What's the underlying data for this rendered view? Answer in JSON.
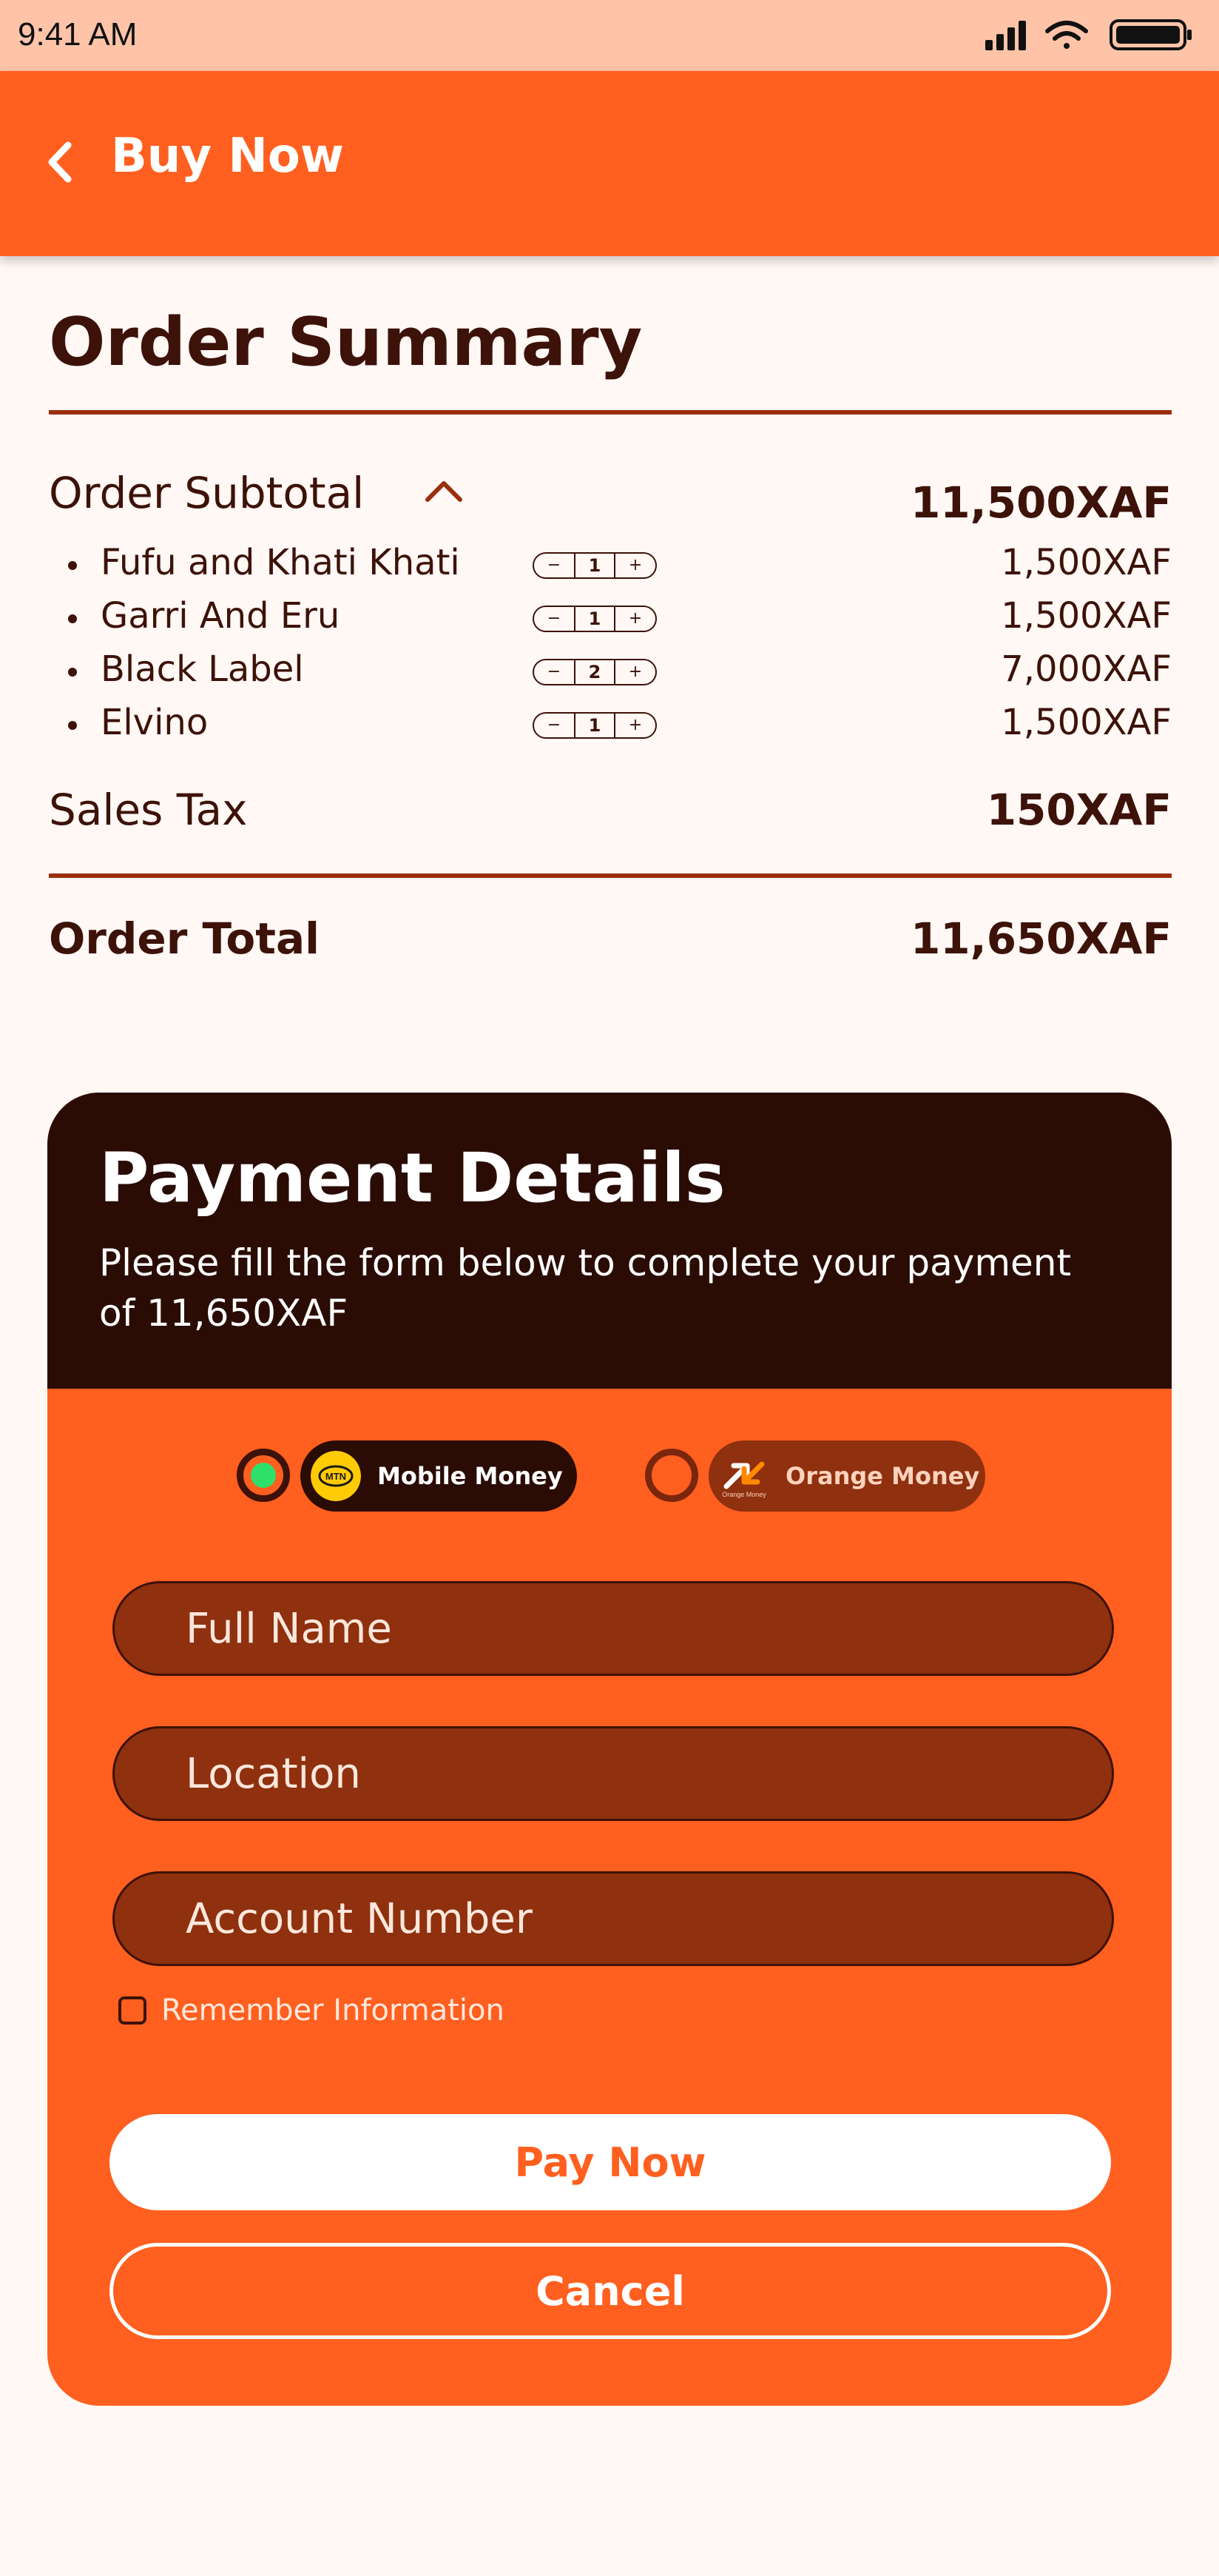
{
  "status_bar": {
    "time": "9:41 AM"
  },
  "app_bar": {
    "title": "Buy Now"
  },
  "order_summary": {
    "title": "Order Summary",
    "subtotal_label": "Order Subtotal",
    "subtotal_value": "11,500XAF",
    "items": [
      {
        "name": "Fufu and Khati Khati",
        "qty": "1",
        "price": "1,500XAF"
      },
      {
        "name": "Garri And Eru",
        "qty": "1",
        "price": "1,500XAF"
      },
      {
        "name": "Black Label",
        "qty": "2",
        "price": "7,000XAF"
      },
      {
        "name": "Elvino",
        "qty": "1",
        "price": "1,500XAF"
      }
    ],
    "stepper": {
      "minus": "−",
      "plus": "+"
    },
    "tax_label": "Sales Tax",
    "tax_value": "150XAF",
    "total_label": "Order Total",
    "total_value": "11,650XAF"
  },
  "payment": {
    "title": "Payment Details",
    "subtitle": "Please fill the form below to complete your payment of 11,650XAF",
    "methods": [
      {
        "label": "Mobile Money",
        "logo_text": "MTN",
        "selected": true
      },
      {
        "label": "Orange Money",
        "logo_text": "Orange Money",
        "selected": false
      }
    ],
    "fields": {
      "full_name_placeholder": "Full Name",
      "location_placeholder": "Location",
      "account_number_placeholder": "Account Number"
    },
    "remember_label": "Remember Information",
    "pay_button": "Pay Now",
    "cancel_button": "Cancel"
  },
  "colors": {
    "brand_orange": "#ff5f1f",
    "dark_brown": "#2a0c05",
    "text_brown": "#3d1208",
    "selected_green": "#2ee06a"
  }
}
